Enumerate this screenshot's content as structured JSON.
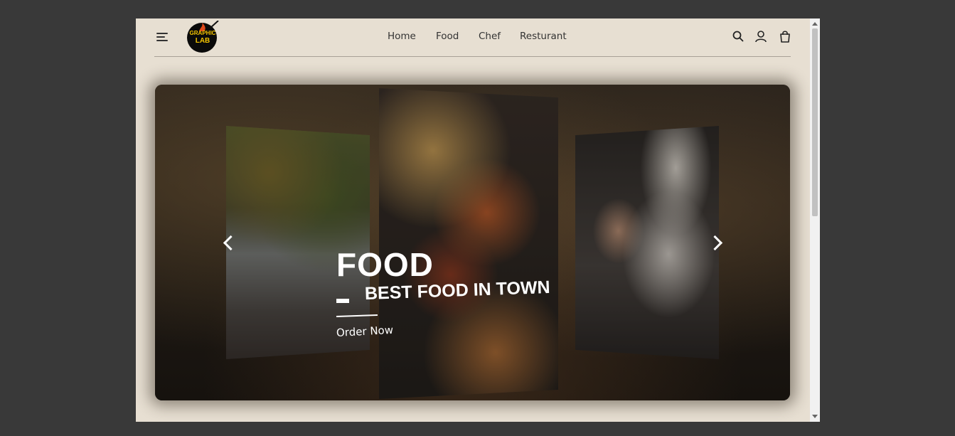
{
  "logo": {
    "line1": "GRAPHIC",
    "line2": "LAB"
  },
  "nav": {
    "links": [
      "Home",
      "Food",
      "Chef",
      "Resturant"
    ]
  },
  "icons": {
    "menu": "hamburger-menu-icon",
    "search": "search-icon",
    "user": "user-icon",
    "cart": "shopping-bag-icon",
    "prev": "chevron-left-icon",
    "next": "chevron-right-icon"
  },
  "hero": {
    "title": "FOOD",
    "subtitle": "BEST FOOD IN TOWN",
    "cta": "Order Now"
  },
  "colors": {
    "page_background": "#e7dfd2",
    "desktop_background": "#393939",
    "text": "#333333",
    "logo_yellow": "#f3c400"
  }
}
